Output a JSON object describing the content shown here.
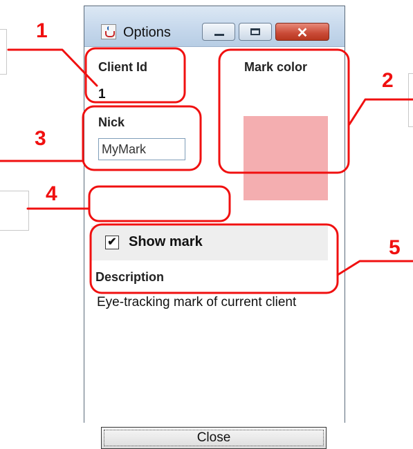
{
  "window": {
    "title": "Options",
    "close_glyph": "✕"
  },
  "fields": {
    "client_id_label": "Client Id",
    "client_id_value": "1",
    "mark_color_label": "Mark color",
    "mark_color_value": "#f4aeb0",
    "nick_label": "Nick",
    "nick_value": "MyMark",
    "show_mark_label": "Show mark",
    "show_mark_checked": "✔",
    "description_label": "Description",
    "description_text": "Eye-tracking mark of current client"
  },
  "buttons": {
    "close_label": "Close"
  },
  "annotations": {
    "numbers": [
      "1",
      "2",
      "3",
      "4",
      "5"
    ],
    "color": "#f01010"
  },
  "icons": [
    "java-app-icon",
    "minimize-icon",
    "maximize-icon",
    "close-icon",
    "checkmark-icon"
  ]
}
